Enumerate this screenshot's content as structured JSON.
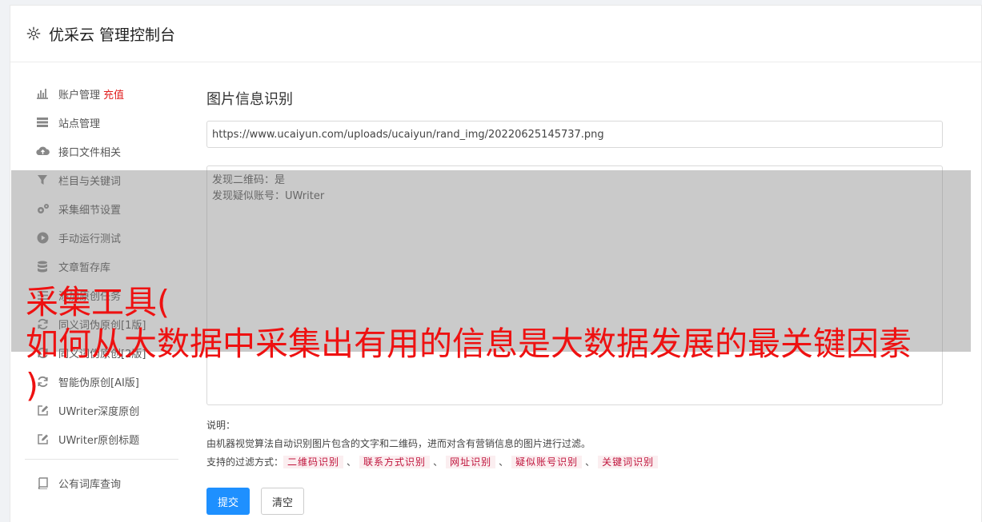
{
  "header": {
    "title": "优采云 管理控制台"
  },
  "sidebar": {
    "items": [
      {
        "label": "账户管理",
        "badge": "充值",
        "icon": "bar-chart-icon"
      },
      {
        "label": "站点管理",
        "icon": "server-icon"
      },
      {
        "label": "接口文件相关",
        "icon": "cloud-upload-icon"
      },
      {
        "label": "栏目与关键词",
        "icon": "filter-icon"
      },
      {
        "label": "采集细节设置",
        "icon": "gears-icon"
      },
      {
        "label": "手动运行测试",
        "icon": "play-circle-icon"
      },
      {
        "label": "文章暂存库",
        "icon": "database-icon"
      },
      {
        "label": "添加原创任务",
        "icon": "list-icon"
      },
      {
        "label": "同义词伪原创[1版]",
        "icon": "refresh-icon"
      },
      {
        "label": "同义词伪原创[2版]",
        "icon": "refresh-icon"
      },
      {
        "label": "智能伪原创[AI版]",
        "icon": "refresh-icon"
      },
      {
        "label": "UWriter深度原创",
        "icon": "edit-icon"
      },
      {
        "label": "UWriter原创标题",
        "icon": "edit-icon"
      }
    ],
    "bottom_items": [
      {
        "label": "公有词库查询",
        "icon": "book-icon"
      }
    ]
  },
  "main": {
    "title": "图片信息识别",
    "url_value": "https://www.ucaiyun.com/uploads/ucaiyun/rand_img/20220625145737.png",
    "result_text": "发现二维码：是\n发现疑似账号：UWriter",
    "desc_heading": "说明：",
    "desc_line": "由机器视觉算法自动识别图片包含的文字和二维码，进而对含有营销信息的图片进行过滤。",
    "filter_label": "支持的过滤方式：",
    "filter_tags": [
      "二维码识别",
      "联系方式识别",
      "网址识别",
      "疑似账号识别",
      "关键词识别"
    ],
    "filter_separator": "、",
    "submit_label": "提交",
    "clear_label": "清空"
  },
  "overlay": {
    "line1": "采集工具(",
    "line2": "如何从大数据中采集出有用的信息是大数据发展的最关键因素",
    "line3": ")"
  },
  "colors": {
    "primary": "#1e90ff",
    "badge": "#e02020",
    "tag_text": "#c0143c",
    "tag_bg": "#fbeef0",
    "overlay_text": "#ee1111"
  }
}
